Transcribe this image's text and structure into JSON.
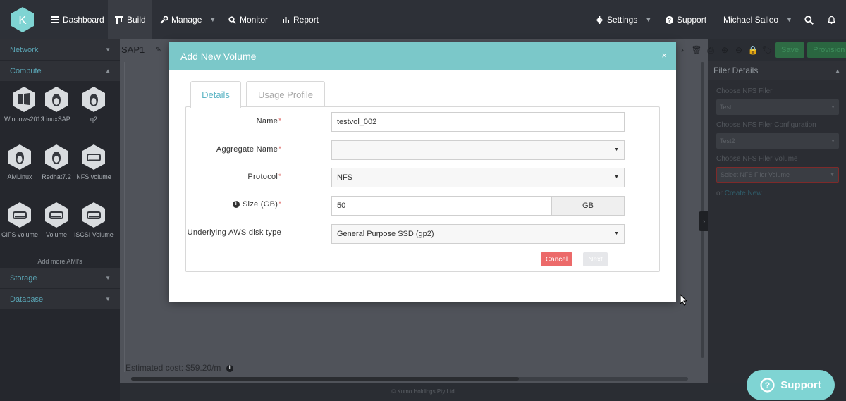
{
  "nav": {
    "logo_letter": "K",
    "items": [
      {
        "label": "Dashboard",
        "icon": "menu-icon"
      },
      {
        "label": "Build",
        "icon": "build-icon"
      },
      {
        "label": "Manage",
        "icon": "wrench-icon"
      },
      {
        "label": "Monitor",
        "icon": "search-icon"
      },
      {
        "label": "Report",
        "icon": "bar-chart-icon"
      }
    ],
    "settings": "Settings",
    "support": "Support",
    "user": "Michael Salleo"
  },
  "sidebar": {
    "sections": {
      "network": "Network",
      "compute": "Compute",
      "storage": "Storage",
      "database": "Database"
    },
    "amis": [
      {
        "label": "Windows2012",
        "icon": "windows-icon"
      },
      {
        "label": "LinuxSAP",
        "icon": "linux-icon"
      },
      {
        "label": "q2",
        "icon": "linux-icon"
      },
      {
        "label": "AMLinux",
        "icon": "linux-icon"
      },
      {
        "label": "Redhat7.2",
        "icon": "linux-icon"
      },
      {
        "label": "NFS volume",
        "icon": "disk-icon"
      },
      {
        "label": "CIFS volume",
        "icon": "disk-icon"
      },
      {
        "label": "Volume",
        "icon": "disk-icon"
      },
      {
        "label": "iSCSI Volume",
        "icon": "disk-icon"
      }
    ],
    "add_more": "Add more AMI's"
  },
  "canvas": {
    "title": "SAP1",
    "estimated_cost": "Estimated cost: $59.20/m",
    "save": "Save",
    "provision": "Provision"
  },
  "filer": {
    "title": "Filer Details",
    "choose_filer_label": "Choose NFS Filer",
    "choose_filer_value": "Test",
    "choose_config_label": "Choose NFS Filer Configuration",
    "choose_config_value": "Test2",
    "choose_volume_label": "Choose NFS Filer Volume",
    "choose_volume_placeholder": "Select NFS Filer Volume",
    "create_prefix": "or",
    "create_link": "Create New"
  },
  "footer": "© Kumo Holdings Pty Ltd",
  "support_bubble": "Support",
  "modal": {
    "title": "Add New Volume",
    "close": "×",
    "tabs": [
      "Details",
      "Usage Profile"
    ],
    "fields": {
      "name_label": "Name",
      "name_value": "testvol_002",
      "aggregate_label": "Aggregate Name",
      "aggregate_value": "",
      "protocol_label": "Protocol",
      "protocol_value": "NFS",
      "size_label": "Size (GB)",
      "size_value": "50",
      "size_unit": "GB",
      "disk_label": "Underlying AWS disk type",
      "disk_value": "General Purpose SSD (gp2)"
    },
    "required_mark": "*",
    "cancel": "Cancel",
    "next": "Next"
  },
  "colors": {
    "modal_header": "#7bc8c9",
    "active_tab": "#5bb4c4",
    "cancel": "#ec6a6a",
    "support_bubble": "#7fd4d3",
    "nav_bg": "#2d3037"
  }
}
